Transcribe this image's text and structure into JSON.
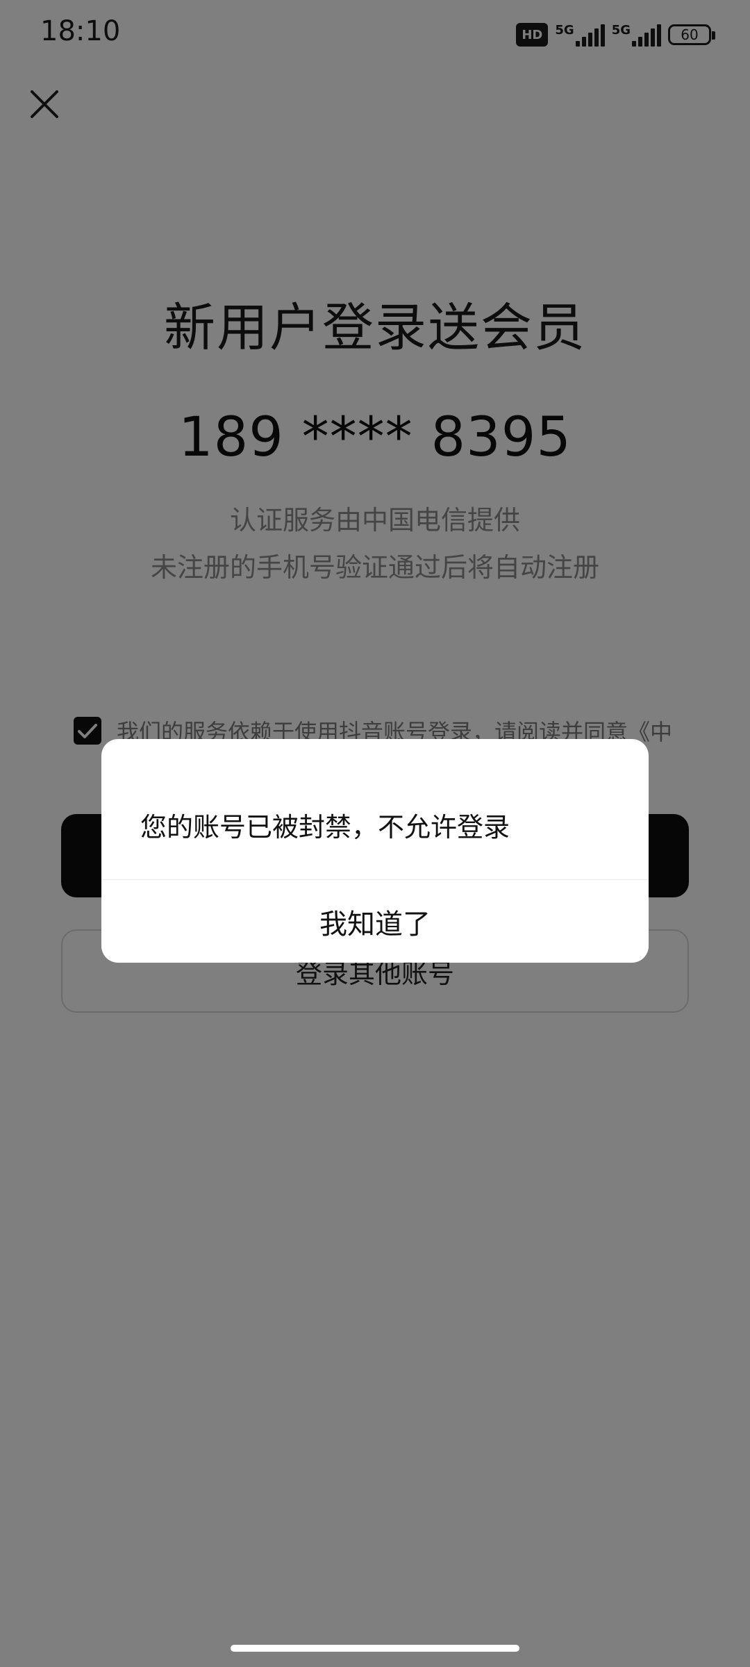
{
  "status_bar": {
    "time": "18:10",
    "hd_label": "HD",
    "network_1": "5G",
    "network_2": "5G",
    "battery": "60"
  },
  "page": {
    "title": "新用户登录送会员",
    "phone_masked": "189 **** 8395",
    "auth_provider_text": "认证服务由中国电信提供",
    "auto_register_text": "未注册的手机号验证通过后将自动注册",
    "agreement_text": "我们的服务依赖于使用抖音账号登录，请阅读并同意《中",
    "agreement_checked": true,
    "primary_button_label": "",
    "other_account_button_label": "登录其他账号"
  },
  "dialog": {
    "message": "您的账号已被封禁，不允许登录",
    "confirm_label": "我知道了"
  },
  "colors": {
    "overlay": "rgba(0,0,0,0.5)",
    "primary_button": "#0d0d0d",
    "dialog_bg": "#ffffff",
    "secondary_text": "#8a8a8a"
  }
}
